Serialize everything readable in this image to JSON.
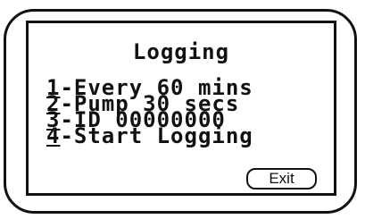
{
  "screen": {
    "title": "Logging",
    "menu": [
      {
        "number": "1",
        "label": "-Every 60 mins"
      },
      {
        "number": "2",
        "label": "-Pump 30 secs"
      },
      {
        "number": "3",
        "label": "-ID 00000000"
      },
      {
        "number": "4",
        "label": "-Start Logging"
      }
    ],
    "exit_label": "Exit"
  },
  "colors": {
    "foreground": "#111111",
    "background": "#ffffff"
  }
}
